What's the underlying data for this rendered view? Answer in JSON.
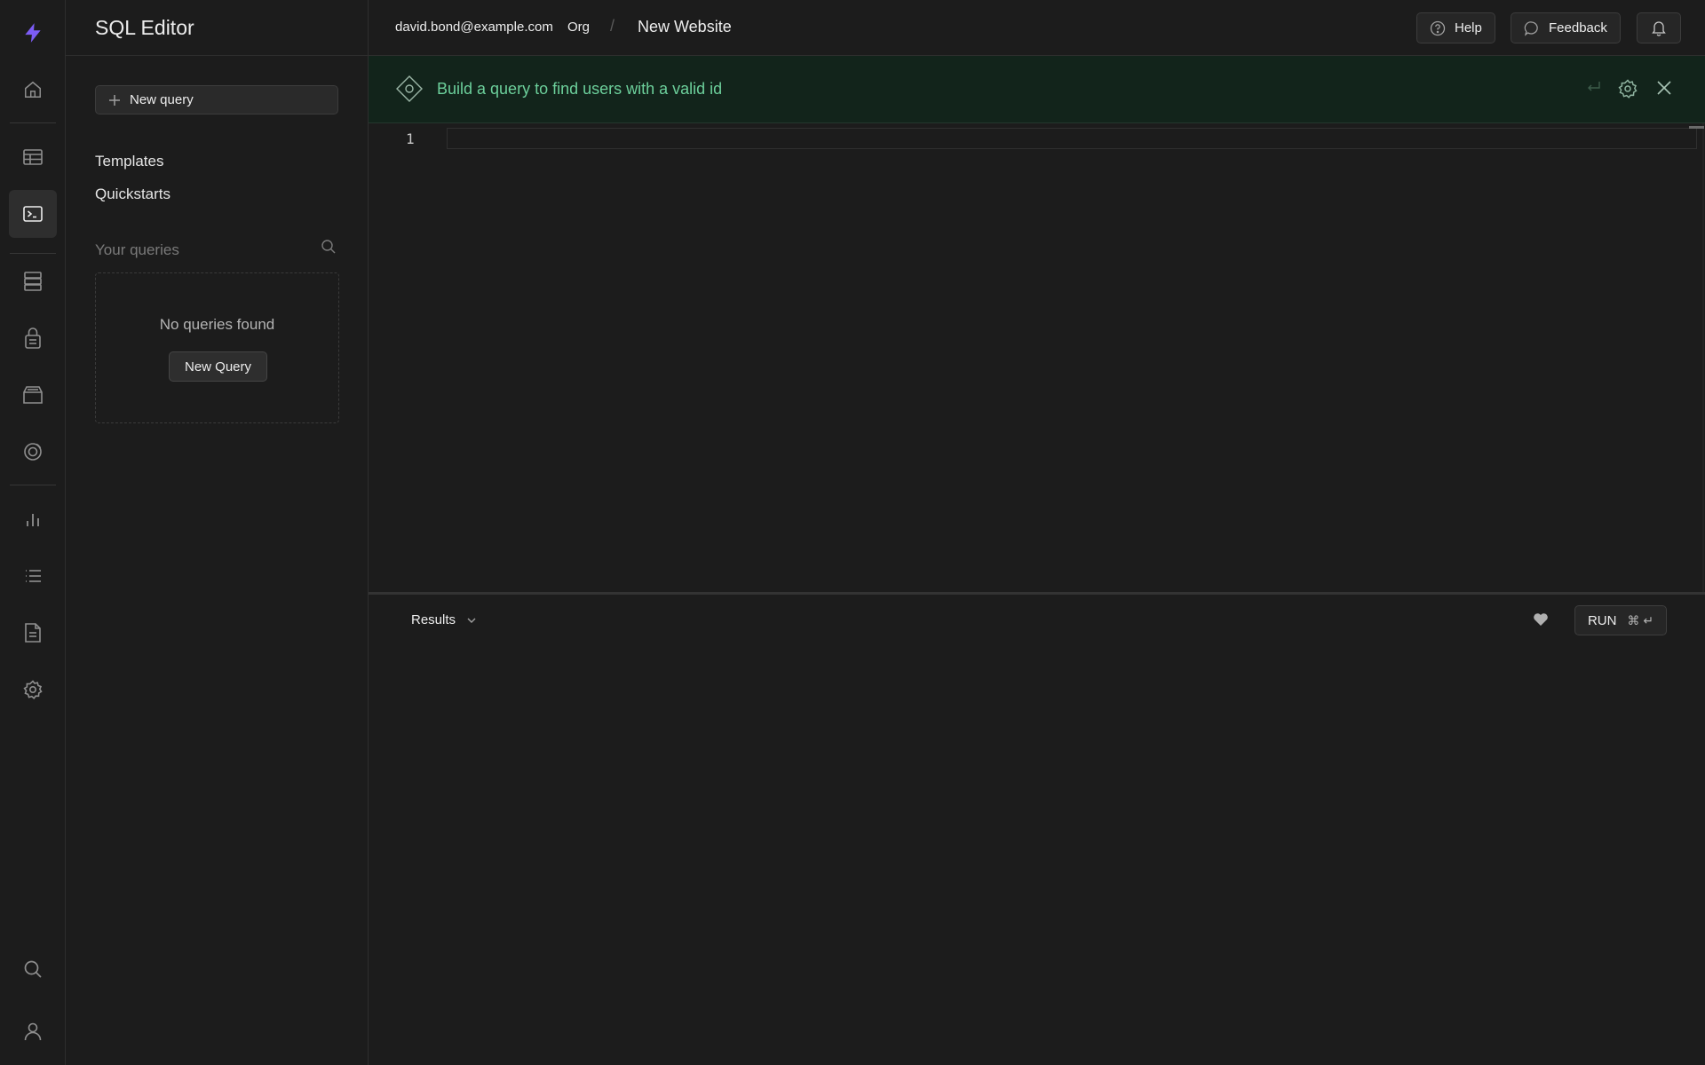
{
  "sidebar": {
    "title": "SQL Editor",
    "new_query_label": "New query",
    "links": [
      "Templates",
      "Quickstarts"
    ],
    "your_queries_label": "Your queries",
    "empty_message": "No queries found",
    "empty_button_label": "New Query"
  },
  "rail": {
    "icons": [
      "logo-bolt-icon",
      "home-icon",
      "table-editor-icon",
      "sql-editor-icon",
      "database-icon",
      "auth-lock-icon",
      "storage-icon",
      "realtime-icon",
      "reports-chart-icon",
      "logs-list-icon",
      "api-docs-icon",
      "settings-gear-icon",
      "search-icon",
      "user-icon"
    ],
    "active": "sql-editor-icon"
  },
  "topbar": {
    "email": "david.bond@example.com",
    "org": "Org",
    "separator": "/",
    "project": "New Website",
    "help_label": "Help",
    "feedback_label": "Feedback"
  },
  "assistant": {
    "prompt": "Build a query to find users with a valid id"
  },
  "editor": {
    "line_numbers": [
      "1"
    ]
  },
  "results": {
    "tab_label": "Results",
    "run_label": "RUN",
    "run_shortcut": "⌘ ↵"
  },
  "colors": {
    "accent_brand": "#7c5cf5",
    "assistant_bg": "#12241b",
    "assistant_text": "#6ccf9b",
    "background": "#1c1c1c"
  }
}
